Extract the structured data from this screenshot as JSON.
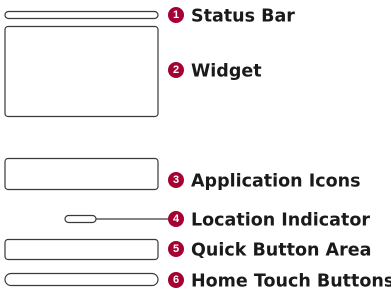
{
  "callouts": [
    {
      "id": "status-bar",
      "number": "1",
      "label": "Status Bar"
    },
    {
      "id": "widget",
      "number": "2",
      "label": "Widget"
    },
    {
      "id": "application-icons",
      "number": "3",
      "label": "Application Icons"
    },
    {
      "id": "location-indicator",
      "number": "4",
      "label": "Location Indicator"
    },
    {
      "id": "quick-button-area",
      "number": "5",
      "label": "Quick Button Area"
    },
    {
      "id": "home-touch-buttons",
      "number": "6",
      "label": "Home Touch Buttons"
    }
  ],
  "colors": {
    "badge": "#a50034",
    "outline": "#3a3a3a",
    "text": "#1a1a1a"
  }
}
